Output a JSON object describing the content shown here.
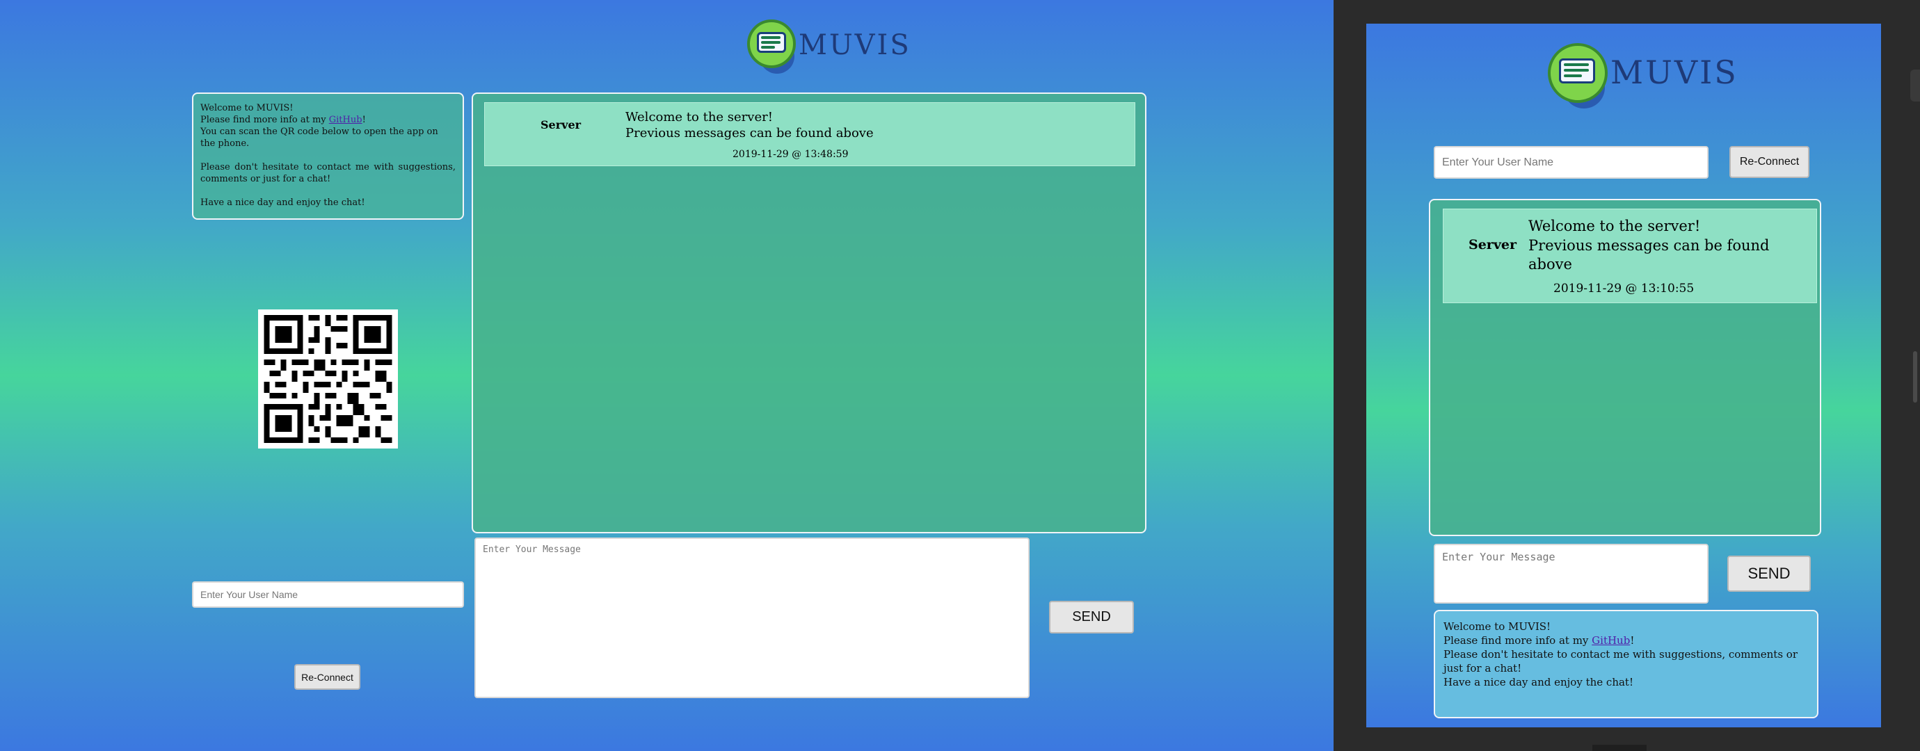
{
  "desktop": {
    "logo": {
      "text": "MUVIS",
      "icon": "chat-bubble-logo-icon"
    },
    "info": {
      "welcome": "Welcome to MUVIS!",
      "more_info_prefix": "Please find more info at my ",
      "github_link": "GitHub",
      "more_info_suffix": "!",
      "qr_text": "You can scan the QR code below to open the app on the phone.",
      "contact": "Please don't hesitate to contact me with suggestions, comments or just for a chat!",
      "goodbye": "Have a nice day and enjoy the chat!"
    },
    "qr_icon": "qr-code-icon",
    "chat": {
      "messages": [
        {
          "author": "Server",
          "line1": "Welcome to the server!",
          "line2": "Previous messages can be found above",
          "time": "2019-11-29 @ 13:48:59"
        }
      ]
    },
    "username": {
      "placeholder": "Enter Your User Name",
      "value": ""
    },
    "reconnect_label": "Re-Connect",
    "message": {
      "placeholder": "Enter Your Message",
      "value": ""
    },
    "send_label": "SEND"
  },
  "mobile": {
    "logo": {
      "text": "MUVIS",
      "icon": "chat-bubble-logo-icon"
    },
    "username": {
      "placeholder": "Enter Your User Name",
      "value": ""
    },
    "reconnect_label": "Re-Connect",
    "chat": {
      "messages": [
        {
          "author": "Server",
          "line1": "Welcome to the server!",
          "line2": "Previous messages can be found",
          "line3": "above",
          "time": "2019-11-29 @ 13:10:55"
        }
      ]
    },
    "message": {
      "placeholder": "Enter Your Message",
      "value": ""
    },
    "send_label": "SEND",
    "info": {
      "welcome": "Welcome to MUVIS!",
      "more_info_prefix": "Please find more info at my ",
      "github_link": "GitHub",
      "more_info_suffix": "!",
      "contact": "Please don't hesitate to contact me with suggestions, comments or just for a chat!",
      "goodbye": "Have a nice day and enjoy the chat!"
    }
  },
  "colors": {
    "gradient_blue": "#3c78e0",
    "gradient_green": "#46d59c",
    "panel_teal": "#48b496",
    "message_row": "#8ee0c4",
    "mobile_info_blue": "#66bde0",
    "logo_green": "#7fd44a",
    "logo_navy": "#1e3a78",
    "link_purple": "#5020a8"
  }
}
